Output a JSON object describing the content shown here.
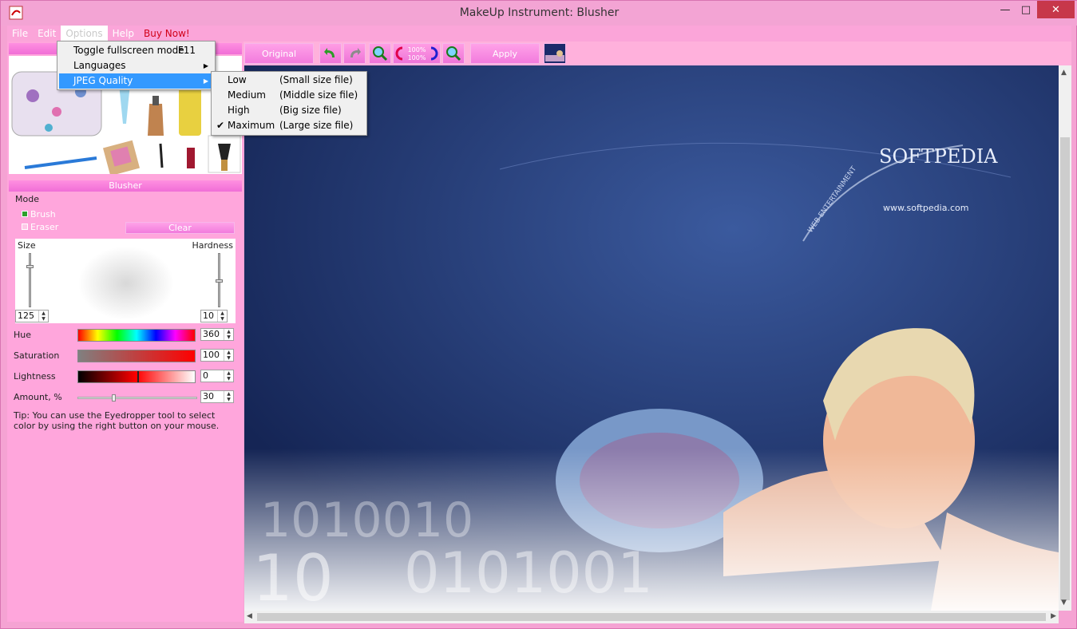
{
  "window": {
    "title": "MakeUp Instrument: Blusher",
    "minimize": "—",
    "maximize": "□",
    "close": "✕"
  },
  "menu": {
    "file": "File",
    "edit": "Edit",
    "options": "Options",
    "help": "Help",
    "buy": "Buy Now!"
  },
  "options_menu": {
    "toggle": "Toggle fullscreen mode",
    "toggle_key": "F11",
    "languages": "Languages",
    "jpeg": "JPEG Quality"
  },
  "jpeg_menu": [
    {
      "name": "Low",
      "desc": "(Small size file)"
    },
    {
      "name": "Medium",
      "desc": "(Middle size file)"
    },
    {
      "name": "High",
      "desc": "(Big size file)"
    },
    {
      "name": "Maximum",
      "desc": "(Large size file)",
      "checked": true
    }
  ],
  "toolbar": {
    "original": "Original",
    "apply": "Apply",
    "zoom_label": "100%"
  },
  "panel": {
    "header": "Blusher",
    "mode": "Mode",
    "brush": "Brush",
    "eraser": "Eraser",
    "clear": "Clear",
    "size": "Size",
    "hardness": "Hardness",
    "size_val": "125",
    "hardness_val": "10",
    "hue": "Hue",
    "hue_val": "360",
    "sat": "Saturation",
    "sat_val": "100",
    "light": "Lightness",
    "light_val": "0",
    "amount": "Amount, %",
    "amount_val": "30",
    "tip": "Tip: You can use the Eyedropper tool to select color by using the right button on your mouse."
  },
  "canvas": {
    "logo": "SOFTPEDIA",
    "url": "www.softpedia.com",
    "tagline": "WEB ENTERTAINMENT"
  }
}
